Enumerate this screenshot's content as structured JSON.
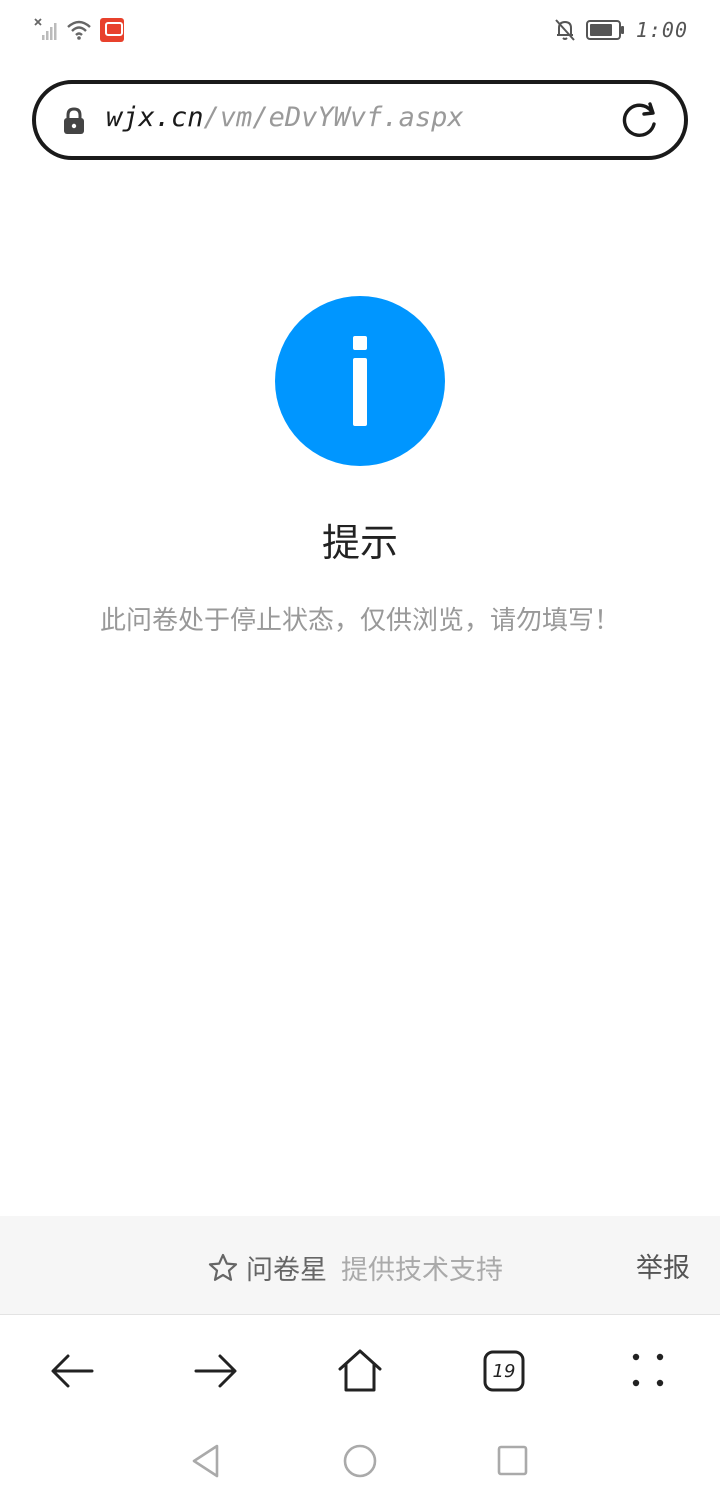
{
  "status_bar": {
    "time": "1:00",
    "icons": [
      "signal-off-icon",
      "wifi-icon",
      "app-notification-icon",
      "bell-muted-icon",
      "battery-icon"
    ]
  },
  "address_bar": {
    "url_host": "wjx.cn",
    "url_path": "/vm/eDvYWvf.aspx",
    "icons": [
      "lock-icon",
      "reload-icon"
    ]
  },
  "notice": {
    "icon": "info-icon",
    "icon_color": "#0096ff",
    "title": "提示",
    "message": "此问卷处于停止状态，仅供浏览，请勿填写！"
  },
  "footer": {
    "brand": "问卷星",
    "support_text": "提供技术支持",
    "report_label": "举报",
    "icons": [
      "star-icon"
    ]
  },
  "browser_nav": {
    "tab_count": "19",
    "icons": [
      "back-arrow-icon",
      "forward-arrow-icon",
      "home-icon",
      "tabs-icon",
      "menu-icon"
    ]
  },
  "system_nav": {
    "icons": [
      "system-back-icon",
      "system-home-icon",
      "system-recents-icon"
    ]
  }
}
